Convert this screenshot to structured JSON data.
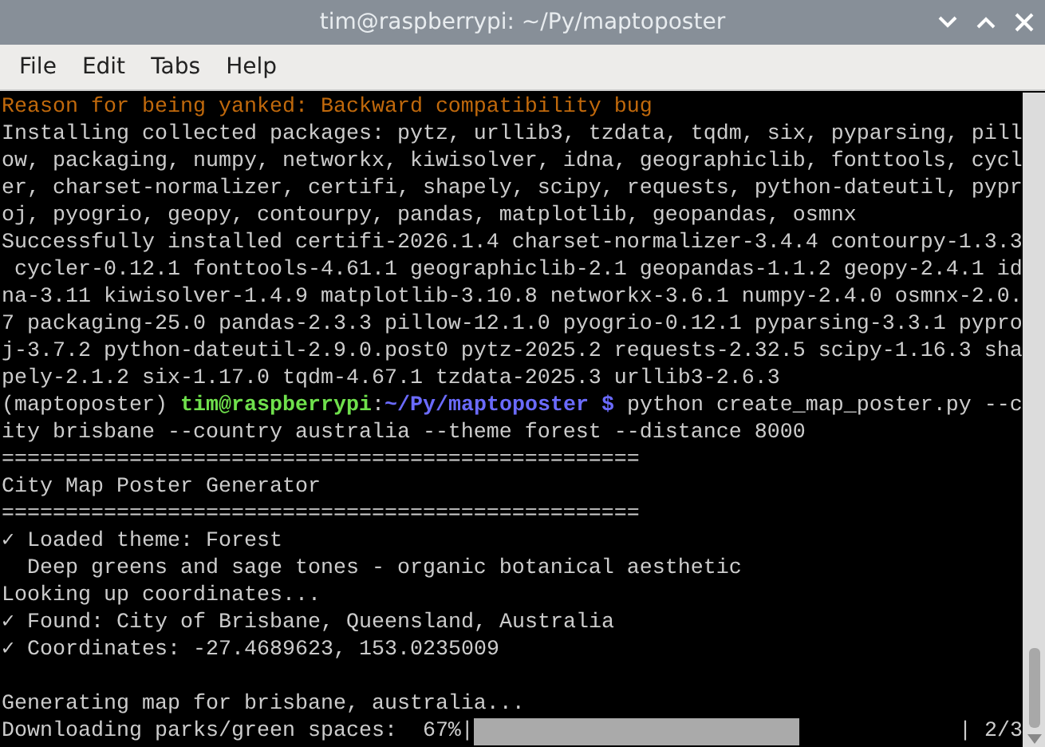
{
  "window": {
    "title": "tim@raspberrypi: ~/Py/maptoposter"
  },
  "menu": [
    "File",
    "Edit",
    "Tabs",
    "Help"
  ],
  "terminal": {
    "lines": [
      {
        "kind": "warning",
        "text": "Reason for being yanked: Backward compatibility bug"
      },
      {
        "kind": "plain",
        "text": "Installing collected packages: pytz, urllib3, tzdata, tqdm, six, pyparsing, pill"
      },
      {
        "kind": "plain",
        "text": "ow, packaging, numpy, networkx, kiwisolver, idna, geographiclib, fonttools, cycl"
      },
      {
        "kind": "plain",
        "text": "er, charset-normalizer, certifi, shapely, scipy, requests, python-dateutil, pypr"
      },
      {
        "kind": "plain",
        "text": "oj, pyogrio, geopy, contourpy, pandas, matplotlib, geopandas, osmnx"
      },
      {
        "kind": "plain",
        "text": "Successfully installed certifi-2026.1.4 charset-normalizer-3.4.4 contourpy-1.3.3"
      },
      {
        "kind": "plain",
        "text": " cycler-0.12.1 fonttools-4.61.1 geographiclib-2.1 geopandas-1.1.2 geopy-2.4.1 id"
      },
      {
        "kind": "plain",
        "text": "na-3.11 kiwisolver-1.4.9 matplotlib-3.10.8 networkx-3.6.1 numpy-2.4.0 osmnx-2.0."
      },
      {
        "kind": "plain",
        "text": "7 packaging-25.0 pandas-2.3.3 pillow-12.1.0 pyogrio-0.12.1 pyparsing-3.3.1 pypro"
      },
      {
        "kind": "plain",
        "text": "j-3.7.2 python-dateutil-2.9.0.post0 pytz-2025.2 requests-2.32.5 scipy-1.16.3 sha"
      },
      {
        "kind": "plain",
        "text": "pely-2.1.2 six-1.17.0 tqdm-4.67.1 tzdata-2025.3 urllib3-2.6.3"
      },
      {
        "kind": "prompt",
        "env": "(maptoposter) ",
        "user": "tim@raspberrypi",
        "sep": ":",
        "path": "~/Py/maptoposter",
        "symbol": " $",
        "command": " python create_map_poster.py --c"
      },
      {
        "kind": "plain",
        "text": "ity brisbane --country australia --theme forest --distance 8000"
      },
      {
        "kind": "plain",
        "text": "=================================================="
      },
      {
        "kind": "plain",
        "text": "City Map Poster Generator"
      },
      {
        "kind": "plain",
        "text": "=================================================="
      },
      {
        "kind": "plain",
        "text": "✓ Loaded theme: Forest"
      },
      {
        "kind": "plain",
        "text": "  Deep greens and sage tones - organic botanical aesthetic"
      },
      {
        "kind": "plain",
        "text": "Looking up coordinates..."
      },
      {
        "kind": "plain",
        "text": "✓ Found: City of Brisbane, Queensland, Australia"
      },
      {
        "kind": "plain",
        "text": "✓ Coordinates: -27.4689623, 153.0235009"
      },
      {
        "kind": "blank"
      },
      {
        "kind": "plain",
        "text": "Generating map for brisbane, australia..."
      },
      {
        "kind": "progress",
        "label": "Downloading parks/green spaces:  67%|",
        "level": 0.67,
        "count": "| 2/3"
      }
    ]
  }
}
